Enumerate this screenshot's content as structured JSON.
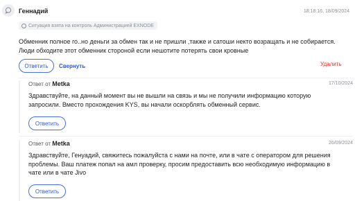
{
  "review": {
    "author": "Геннадий",
    "date": "18:18:16, 18/09/2024",
    "badge": "Ситуация взята на контроль Администрацией EXNODE",
    "text": "Обменник полное го..но деньги за обмен так и не пришли ,также и сатоши некто возращать и не собирается. Люди обходите этот обменник стороной если нешотите потерять свои кровные",
    "reply_label": "Ответить",
    "collapse_label": "Свернуть",
    "delete_label": "Удалить"
  },
  "replies": [
    {
      "prefix": "Ответ от",
      "author": "Metka",
      "date": "17/10/2024",
      "text": "Здравствуйте, на данный момент вы не вышли на связь и мы не получили информацию которую запросили. Вместо прохождения KYS, вы начали оскорблять обменный сервис.",
      "reply_label": "Ответить"
    },
    {
      "prefix": "Ответ от",
      "author": "Metka",
      "date": "26/09/2024",
      "text": "Здравствуйте, Генуадий, свяжитесь пожалуйста с нами на почте, или в чате с оператором для решения проблемы. Ваш платеж попал на амл проверку, просим предоставить всю необходимую информацию в чате или в чате Jivo",
      "reply_label": "Ответить"
    }
  ]
}
